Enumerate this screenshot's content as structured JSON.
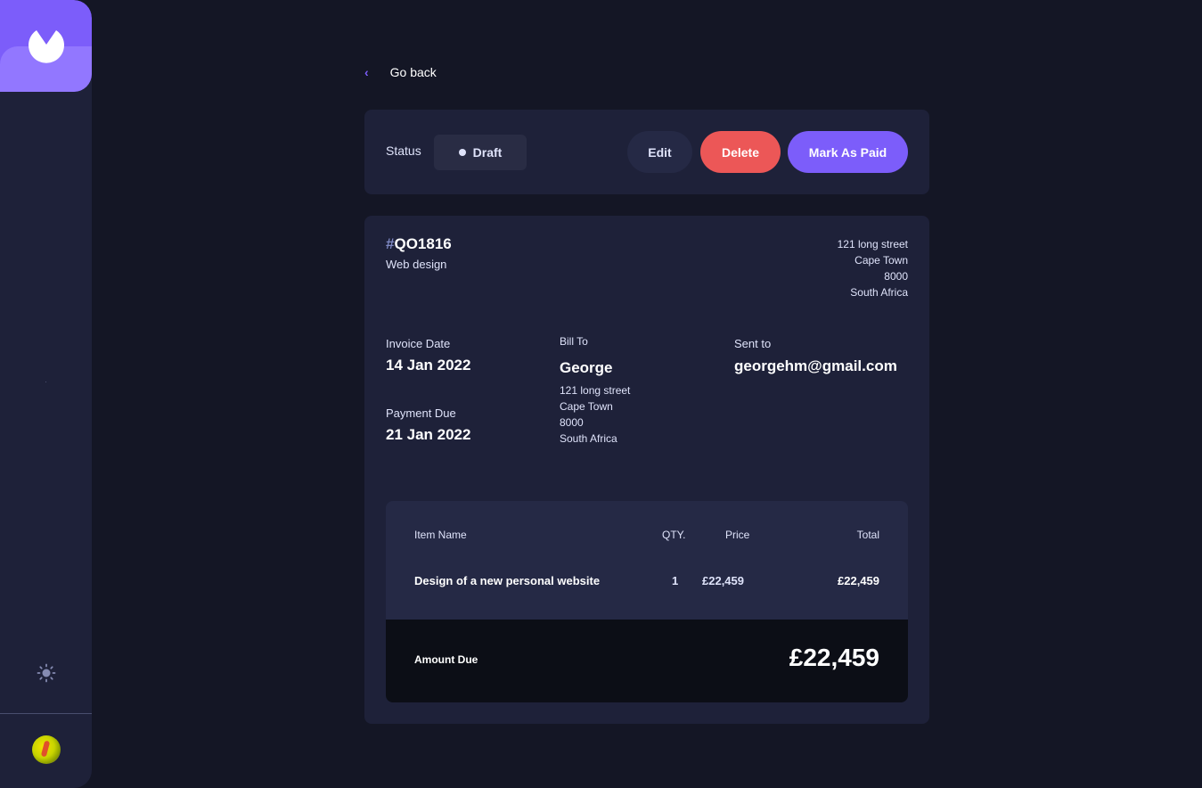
{
  "nav": {
    "back_label": "Go back"
  },
  "status_bar": {
    "status_label": "Status",
    "status_value": "Draft",
    "edit_label": "Edit",
    "delete_label": "Delete",
    "mark_paid_label": "Mark As Paid"
  },
  "invoice": {
    "id_hash": "#",
    "id": "QO1816",
    "description": "Web design",
    "sender_address": [
      "121 long street",
      "Cape Town",
      "8000",
      "South Africa"
    ],
    "invoice_date_label": "Invoice Date",
    "invoice_date": "14 Jan 2022",
    "payment_due_label": "Payment Due",
    "payment_due": "21 Jan 2022",
    "bill_to_label": "Bill To",
    "client_name": "George",
    "client_address": [
      "121 long street",
      "Cape Town",
      "8000",
      "South Africa"
    ],
    "sent_to_label": "Sent to",
    "client_email": "georgehm@gmail.com"
  },
  "items": {
    "headers": {
      "name": "Item Name",
      "qty": "QTY.",
      "price": "Price",
      "total": "Total"
    },
    "rows": [
      {
        "name": "Design of a new personal website",
        "qty": "1",
        "price": "£22,459",
        "total": "£22,459"
      }
    ],
    "amount_due_label": "Amount Due",
    "amount_due": "£22,459"
  },
  "colors": {
    "accent": "#7c5dfa",
    "danger": "#ec5757",
    "background": "#141625",
    "card": "#1e2139"
  },
  "icons": [
    "logo-icon",
    "chevron-left-icon",
    "sun-icon",
    "avatar"
  ]
}
